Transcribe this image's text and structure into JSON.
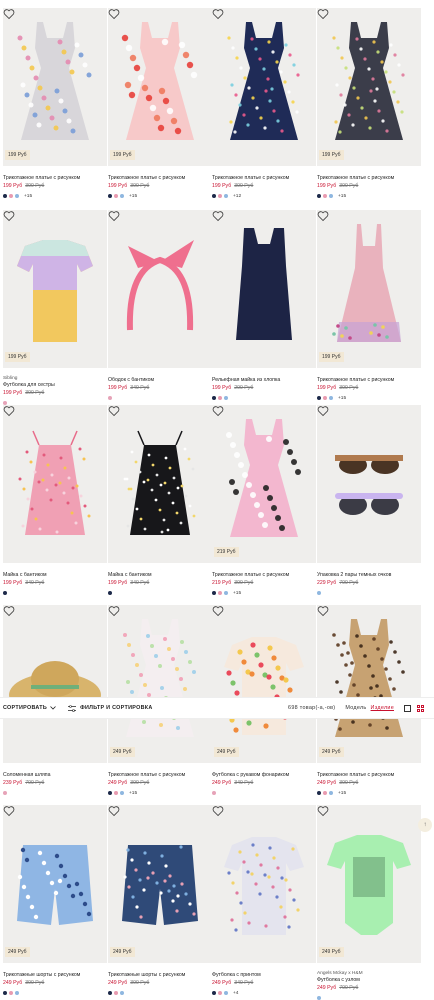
{
  "rows": [
    [
      {
        "title": "Трикотажное платье с рисунком",
        "badge": "199 Руб",
        "price": "199 Руб",
        "old": "399 Руб",
        "swatches": [
          "#1d2a4a",
          "#e89bb0",
          "#8fb7e0"
        ],
        "more": "+15",
        "img": "unicorn-dress"
      },
      {
        "title": "Трикотажное платье с рисунком",
        "badge": "199 Руб",
        "price": "199 Руб",
        "old": "399 Руб",
        "swatches": [
          "#1d2a4a",
          "#e89bb0",
          "#8fb7e0"
        ],
        "more": "+15",
        "img": "apple-dress"
      },
      {
        "title": "Трикотажное платье с рисунком",
        "badge": "",
        "price": "199 Руб",
        "old": "399 Руб",
        "swatches": [
          "#1d2a4a",
          "#e89bb0",
          "#8fb7e0"
        ],
        "more": "+12",
        "img": "navy-floral-dress"
      },
      {
        "title": "Трикотажное платье с рисунком",
        "badge": "199 Руб",
        "price": "199 Руб",
        "old": "399 Руб",
        "swatches": [
          "#1d2a4a",
          "#e89bb0",
          "#8fb7e0"
        ],
        "more": "+15",
        "img": "dark-floral-dress"
      }
    ],
    [
      {
        "brand": "Sibling",
        "title": "Футболка для сестры",
        "badge": "199 Руб",
        "price": "199 Руб",
        "old": "399 Руб",
        "swatches": [
          "#e6a3b8"
        ],
        "more": "",
        "img": "sister-tee"
      },
      {
        "title": "Ободок с бантиком",
        "badge": "",
        "price": "199 Руб",
        "old": "349 Руб",
        "swatches": [
          "#e6a3b8"
        ],
        "more": "",
        "img": "headband"
      },
      {
        "title": "Рельефная майка из хлопка",
        "badge": "",
        "price": "199 Руб",
        "old": "299 Руб",
        "swatches": [
          "#1d2a4a",
          "#e89bb0",
          "#8fb7e0"
        ],
        "more": "",
        "img": "navy-tank"
      },
      {
        "title": "Трикотажное платье с рисунком",
        "badge": "199 Руб",
        "price": "199 Руб",
        "old": "399 Руб",
        "swatches": [
          "#1d2a4a",
          "#e89bb0",
          "#8fb7e0"
        ],
        "more": "+15",
        "img": "pink-dress"
      }
    ],
    [
      {
        "title": "Майка с бантиком",
        "badge": "",
        "price": "199 Руб",
        "old": "349 Руб",
        "swatches": [
          "#1d2a4a"
        ],
        "more": "",
        "img": "pink-cami"
      },
      {
        "title": "Майка с бантиком",
        "badge": "",
        "price": "199 Руб",
        "old": "349 Руб",
        "swatches": [
          "#1d2a4a"
        ],
        "more": "",
        "img": "black-cami"
      },
      {
        "title": "Трикотажное платье с рисунком",
        "badge": "219 Руб",
        "price": "219 Руб",
        "old": "399 Руб",
        "swatches": [
          "#1d2a4a",
          "#e89bb0",
          "#8fb7e0"
        ],
        "more": "+15",
        "img": "football-dress"
      },
      {
        "title": "Упаковка 2 пары темных очков",
        "badge": "",
        "price": "229 Руб",
        "old": "799 Руб",
        "swatches": [
          "#8fb7e0"
        ],
        "more": "",
        "img": "sunglasses"
      }
    ],
    [
      {
        "title": "Соломенная шляпа",
        "badge": "",
        "price": "239 Руб",
        "old": "799 Руб",
        "swatches": [
          "#e6a3b8"
        ],
        "more": "",
        "img": "straw-hat"
      },
      {
        "title": "Трикотажное платье с рисунком",
        "badge": "249 Руб",
        "price": "249 Руб",
        "old": "399 Руб",
        "swatches": [
          "#1d2a4a",
          "#e89bb0",
          "#8fb7e0"
        ],
        "more": "+15",
        "img": "pastel-dress"
      },
      {
        "title": "Футболка с рукавом фонариком",
        "badge": "249 Руб",
        "price": "249 Руб",
        "old": "349 Руб",
        "swatches": [
          "#e6a3b8"
        ],
        "more": "",
        "img": "fruit-tee"
      },
      {
        "title": "Трикотажное платье с рисунком",
        "badge": "249 Руб",
        "price": "249 Руб",
        "old": "399 Руб",
        "swatches": [
          "#1d2a4a",
          "#e89bb0",
          "#8fb7e0"
        ],
        "more": "+15",
        "img": "leopard-dress"
      }
    ],
    [
      {
        "title": "Трикотажные шорты с рисунком",
        "badge": "249 Руб",
        "price": "249 Руб",
        "old": "399 Руб",
        "swatches": [
          "#1d2a4a",
          "#e89bb0",
          "#8fb7e0"
        ],
        "more": "",
        "img": "blue-shorts"
      },
      {
        "title": "Трикотажные шорты с рисунком",
        "badge": "249 Руб",
        "price": "249 Руб",
        "old": "399 Руб",
        "swatches": [
          "#1d2a4a",
          "#e89bb0",
          "#8fb7e0"
        ],
        "more": "",
        "img": "navy-shorts"
      },
      {
        "title": "Футболка с принтом",
        "badge": "",
        "price": "249 Руб",
        "old": "349 Руб",
        "swatches": [
          "#1d2a4a",
          "#e89bb0",
          "#8fb7e0"
        ],
        "more": "+4",
        "img": "floral-tee"
      },
      {
        "brand": "Angels Mckay x H&M",
        "title": "Футболка с узлом",
        "badge": "249 Руб",
        "price": "249 Руб",
        "old": "799 Руб",
        "swatches": [
          "#8fb7e0"
        ],
        "more": "",
        "img": "green-tee"
      }
    ]
  ],
  "filter_bar": {
    "sort_label": "СОРТИРОВАТЬ",
    "filter_label": "ФИЛЬТР И СОРТИРОВКА",
    "count": "698 товар(-а,-ов)",
    "view_model": "Модель",
    "view_product": "Изделие"
  },
  "colors": {
    "accent": "#c8102e",
    "badge_bg": "#f2e8d5"
  },
  "back_to_top_icon": "arrow-up-icon"
}
